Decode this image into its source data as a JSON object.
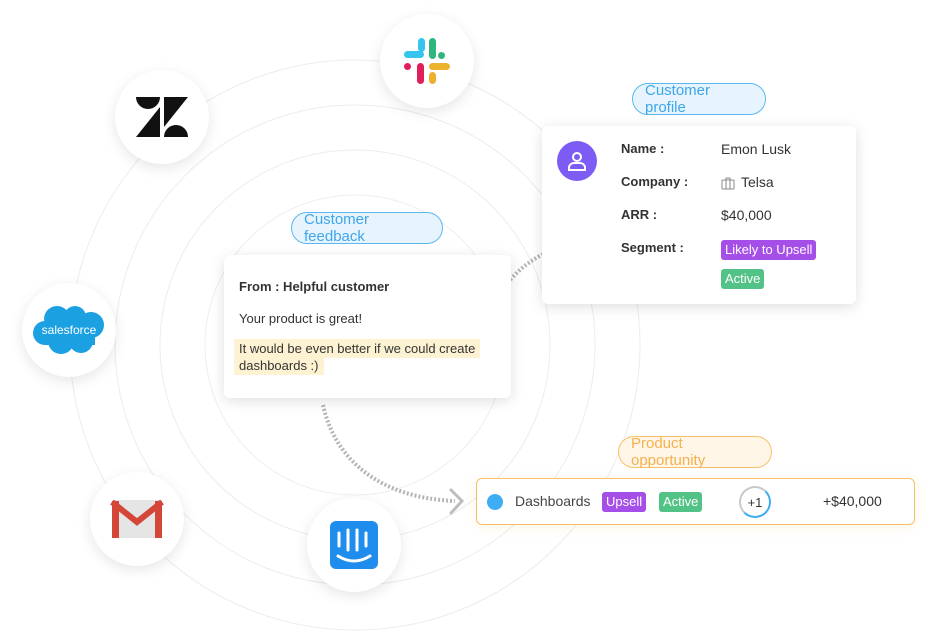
{
  "labels": {
    "customer_profile": "Customer profile",
    "customer_feedback": "Customer feedback",
    "product_opportunity": "Product opportunity"
  },
  "integrations": [
    {
      "name": "Slack",
      "icon": "slack-logo-icon"
    },
    {
      "name": "Zendesk",
      "icon": "zendesk-logo-icon"
    },
    {
      "name": "Salesforce",
      "icon": "salesforce-logo-icon",
      "text": "salesforce"
    },
    {
      "name": "Gmail",
      "icon": "gmail-logo-icon"
    },
    {
      "name": "Intercom",
      "icon": "intercom-logo-icon"
    }
  ],
  "profile": {
    "name_label": "Name :",
    "name_value": "Emon Lusk",
    "company_label": "Company :",
    "company_value": "Telsa",
    "arr_label": "ARR :",
    "arr_value": "$40,000",
    "segment_label": "Segment :",
    "segments": [
      "Likely to Upsell",
      "Active"
    ]
  },
  "feedback": {
    "from": "From : Helpful customer",
    "message": "Your product is great!",
    "highlight": "It would be even better if we could create dashboards :)"
  },
  "opportunity": {
    "title": "Dashboards",
    "tags": [
      "Upsell",
      "Active"
    ],
    "count": "+1",
    "amount": "+$40,000"
  },
  "colors": {
    "accent_blue": "#3ea6ea",
    "accent_orange": "#f4b14d",
    "purple_tag": "#a64ee8",
    "green_tag": "#52c286",
    "avatar": "#7c5cf5"
  }
}
